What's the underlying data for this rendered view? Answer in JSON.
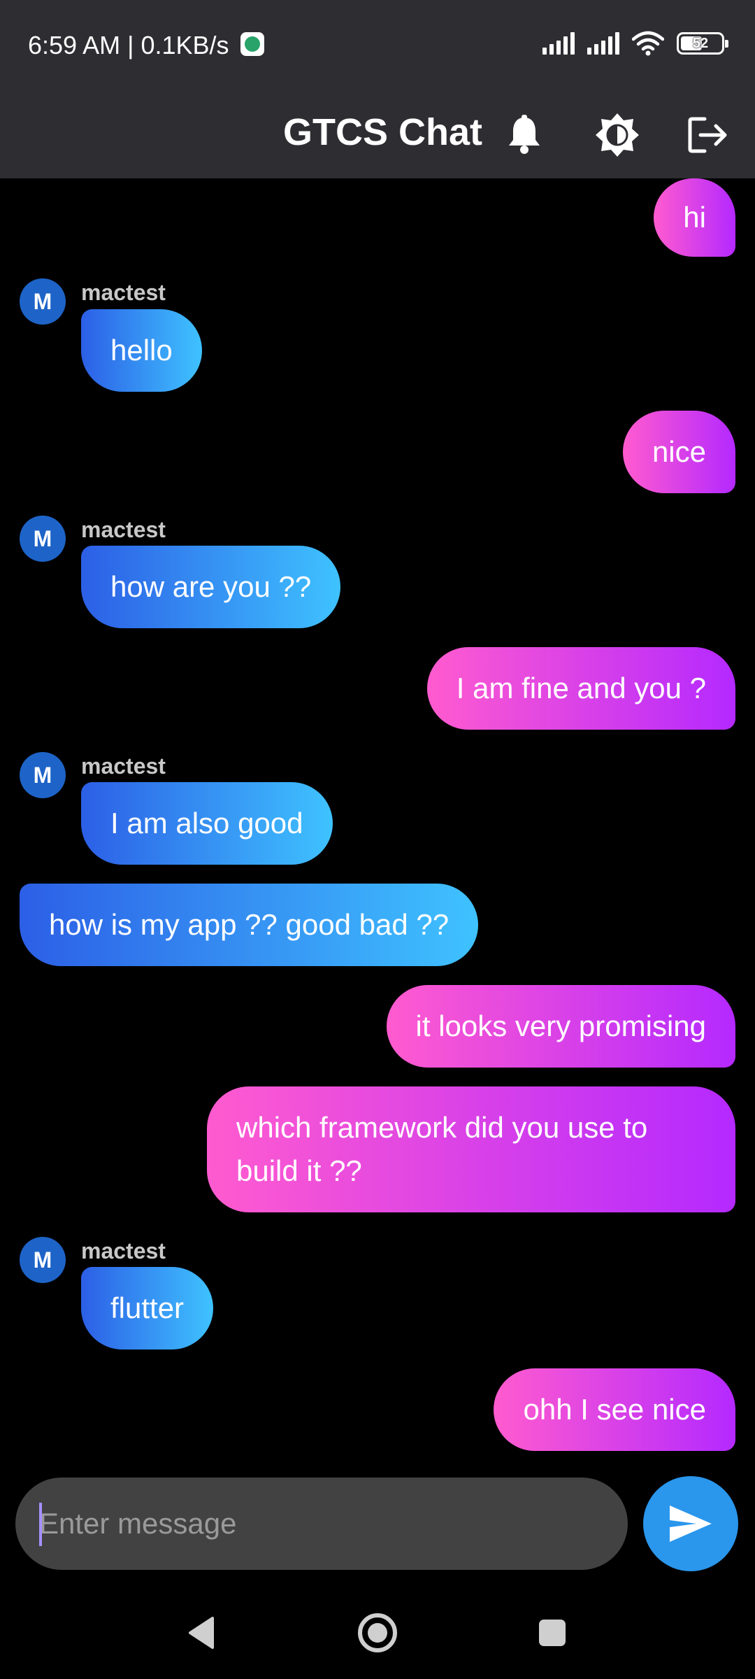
{
  "status_bar": {
    "time_speed": "6:59 AM | 0.1KB/s",
    "battery": "52"
  },
  "app_bar": {
    "title": "GTCS Chat",
    "actions": [
      "bell-icon",
      "brightness-icon",
      "logout-icon"
    ]
  },
  "colors": {
    "outgoing_gradient": [
      "#ff5bcf",
      "#b429ff"
    ],
    "incoming_gradient": [
      "#2c5fe6",
      "#3fc2ff"
    ],
    "app_bar": "#2e2d32",
    "send_button": "#2a96ec",
    "avatar": "#1e64c8"
  },
  "messages": [
    {
      "direction": "out",
      "text": "hi"
    },
    {
      "direction": "in",
      "sender": "mactest",
      "avatar": "M",
      "text": "hello"
    },
    {
      "direction": "out",
      "text": "nice"
    },
    {
      "direction": "in",
      "sender": "mactest",
      "avatar": "M",
      "text": "how are you ??"
    },
    {
      "direction": "out",
      "text": "I am fine and you ?"
    },
    {
      "direction": "in",
      "sender": "mactest",
      "avatar": "M",
      "text": "I am also good"
    },
    {
      "direction": "in",
      "text": "how is my app ?? good bad ??"
    },
    {
      "direction": "out",
      "text": "it looks very promising"
    },
    {
      "direction": "out",
      "text": "which framework did you use to build it ??"
    },
    {
      "direction": "in",
      "sender": "mactest",
      "avatar": "M",
      "text": "flutter"
    },
    {
      "direction": "out",
      "text": "ohh I see nice"
    }
  ],
  "composer": {
    "placeholder": "Enter message",
    "value": ""
  },
  "nav_bar": {
    "buttons": [
      "back-icon",
      "home-icon",
      "recents-icon"
    ]
  }
}
